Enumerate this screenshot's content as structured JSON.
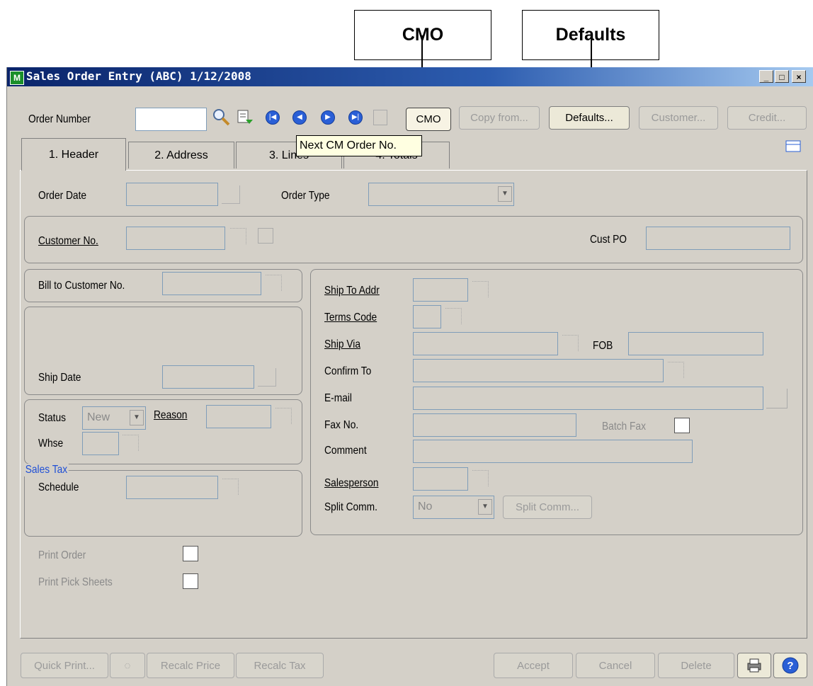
{
  "callouts": {
    "cmo": "CMO",
    "defaults": "Defaults"
  },
  "window": {
    "title": "Sales Order Entry (ABC) 1/12/2008",
    "app_icon_letter": "M"
  },
  "title_buttons": {
    "minimize": "_",
    "maximize": "□",
    "close": "×"
  },
  "toolbar": {
    "order_number_label": "Order Number",
    "order_number_value": "",
    "cmo_button": "CMO",
    "copy_from_button": "Copy from...",
    "defaults_button": "Defaults...",
    "customer_button": "Customer...",
    "credit_button": "Credit..."
  },
  "tooltip": "Next CM Order No.",
  "tabs": [
    {
      "label": "1. Header"
    },
    {
      "label": "2. Address"
    },
    {
      "label": "3. Lines"
    },
    {
      "label": "4. Totals"
    }
  ],
  "header": {
    "order_date_label": "Order Date",
    "order_type_label": "Order Type",
    "customer_no_label": "Customer No.",
    "cust_po_label": "Cust PO",
    "bill_to_label": "Bill to Customer No.",
    "ship_date_label": "Ship Date",
    "status_label": "Status",
    "status_value": "New",
    "reason_label": "Reason",
    "whse_label": "Whse",
    "sales_tax_legend": "Sales Tax",
    "schedule_label": "Schedule",
    "ship_to_addr_label": "Ship To Addr",
    "terms_code_label": "Terms Code",
    "ship_via_label": "Ship Via",
    "fob_label": "FOB",
    "confirm_to_label": "Confirm To",
    "email_label": "E-mail",
    "fax_no_label": "Fax No.",
    "batch_fax_label": "Batch Fax",
    "comment_label": "Comment",
    "salesperson_label": "Salesperson",
    "split_comm_label": "Split Comm.",
    "split_comm_value": "No",
    "split_comm_button": "Split Comm...",
    "print_order_label": "Print Order",
    "print_pick_label": "Print Pick Sheets"
  },
  "bottom": {
    "quick_print": "Quick Print...",
    "recalc_price": "Recalc Price",
    "recalc_tax": "Recalc Tax",
    "accept": "Accept",
    "cancel": "Cancel",
    "delete": "Delete"
  },
  "colors": {
    "titlebar_start": "#0a246a",
    "sales_tax_legend": "#1f4fd6",
    "tooltip_bg": "#ffffe1"
  }
}
